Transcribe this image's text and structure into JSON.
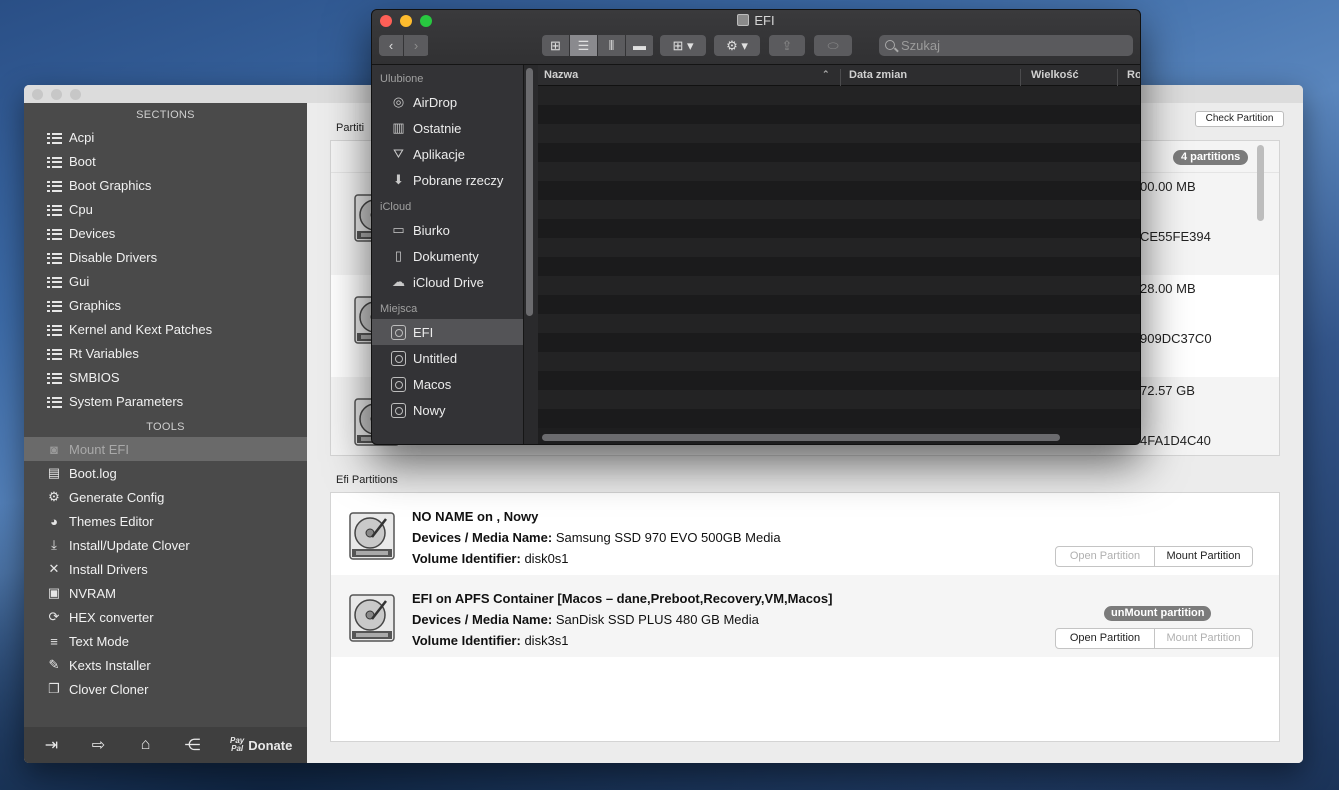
{
  "sidebar": {
    "sections_header": "SECTIONS",
    "sections": [
      {
        "label": "Acpi",
        "icon": "list-icon"
      },
      {
        "label": "Boot",
        "icon": "list-icon"
      },
      {
        "label": "Boot Graphics",
        "icon": "list-icon"
      },
      {
        "label": "Cpu",
        "icon": "list-icon"
      },
      {
        "label": "Devices",
        "icon": "list-icon"
      },
      {
        "label": "Disable Drivers",
        "icon": "list-icon"
      },
      {
        "label": "Gui",
        "icon": "list-icon"
      },
      {
        "label": "Graphics",
        "icon": "list-icon"
      },
      {
        "label": "Kernel and Kext Patches",
        "icon": "list-icon"
      },
      {
        "label": "Rt Variables",
        "icon": "list-icon"
      },
      {
        "label": "SMBIOS",
        "icon": "list-icon"
      },
      {
        "label": "System Parameters",
        "icon": "list-icon"
      }
    ],
    "tools_header": "TOOLS",
    "tools": [
      {
        "label": "Mount EFI",
        "icon": "disk-icon",
        "glyph": "◙"
      },
      {
        "label": "Boot.log",
        "icon": "log-search-icon",
        "glyph": "▤"
      },
      {
        "label": "Generate Config",
        "icon": "gears-icon",
        "glyph": "⚙"
      },
      {
        "label": "Themes Editor",
        "icon": "palette-icon",
        "glyph": "◕"
      },
      {
        "label": "Install/Update Clover",
        "icon": "download-icon",
        "glyph": "⤓"
      },
      {
        "label": "Install Drivers",
        "icon": "tools-icon",
        "glyph": "✕"
      },
      {
        "label": "NVRAM",
        "icon": "chip-icon",
        "glyph": "▣"
      },
      {
        "label": "HEX converter",
        "icon": "refresh-icon",
        "glyph": "⟳"
      },
      {
        "label": "Text Mode",
        "icon": "text-lines-icon",
        "glyph": "≡"
      },
      {
        "label": "Kexts Installer",
        "icon": "plug-icon",
        "glyph": "✎"
      },
      {
        "label": "Clover Cloner",
        "icon": "copy-icon",
        "glyph": "❐"
      }
    ],
    "selected_tool": "Mount EFI",
    "footer": {
      "donate_label": "Donate",
      "paypal_top": "Pay",
      "paypal_bottom": "Pal"
    }
  },
  "main": {
    "check_button": "Check Partition",
    "partitions_label": "Partiti",
    "partitions_count": "4 partitions",
    "partition_rows": [
      {
        "value1": "00.00 MB",
        "value2": "CE55FE394"
      },
      {
        "value1": "28.00 MB",
        "value2": "909DC37C0"
      },
      {
        "value1": "72.57 GB",
        "value2": "4FA1D4C40"
      }
    ],
    "efi_label": "Efi Partitions",
    "efi_rows": [
      {
        "title": "NO NAME on , Nowy",
        "media_key": "Devices / Media Name:",
        "media_value": "Samsung SSD 970 EVO 500GB Media",
        "vol_key": "Volume Identifier:",
        "vol_value": "disk0s1",
        "open_label": "Open Partition",
        "mount_label": "Mount Partition",
        "open_enabled": false,
        "mount_enabled": true
      },
      {
        "title": "EFI on APFS Container [Macos – dane,Preboot,Recovery,VM,Macos]",
        "media_key": "Devices / Media Name:",
        "media_value": "SanDisk SSD PLUS 480 GB Media",
        "vol_key": "Volume Identifier:",
        "vol_value": "disk3s1",
        "badge": "unMount partition",
        "open_label": "Open Partition",
        "mount_label": "Mount Partition",
        "open_enabled": true,
        "mount_enabled": false
      }
    ]
  },
  "finder": {
    "title": "EFI",
    "search_placeholder": "Szukaj",
    "groups": [
      {
        "label": "Ulubione",
        "items": [
          {
            "label": "AirDrop",
            "icon": "airdrop-icon",
            "glyph": "◎"
          },
          {
            "label": "Ostatnie",
            "icon": "recents-icon",
            "glyph": "▥"
          },
          {
            "label": "Aplikacje",
            "icon": "applications-icon",
            "glyph": "⛛"
          },
          {
            "label": "Pobrane rzeczy",
            "icon": "downloads-icon",
            "glyph": "⬇"
          }
        ]
      },
      {
        "label": "iCloud",
        "items": [
          {
            "label": "Biurko",
            "icon": "desktop-icon",
            "glyph": "▭"
          },
          {
            "label": "Dokumenty",
            "icon": "document-icon",
            "glyph": "▯"
          },
          {
            "label": "iCloud Drive",
            "icon": "cloud-icon",
            "glyph": "☁"
          }
        ]
      },
      {
        "label": "Miejsca",
        "items": [
          {
            "label": "EFI",
            "icon": "drive-icon",
            "active": true
          },
          {
            "label": "Untitled",
            "icon": "drive-icon"
          },
          {
            "label": "Macos",
            "icon": "drive-icon"
          },
          {
            "label": "Nowy",
            "icon": "drive-icon"
          }
        ]
      }
    ],
    "columns": {
      "name": "Nazwa",
      "date": "Data zmian",
      "size": "Wielkość",
      "kind": "Ro"
    }
  },
  "colors": {
    "sidebar_bg": "#4a4a4a",
    "finder_bg": "#2a2a2c",
    "badge_bg": "#7b7b7b",
    "close": "#fe5f57",
    "minimize": "#febc2e",
    "zoom": "#28c840"
  }
}
